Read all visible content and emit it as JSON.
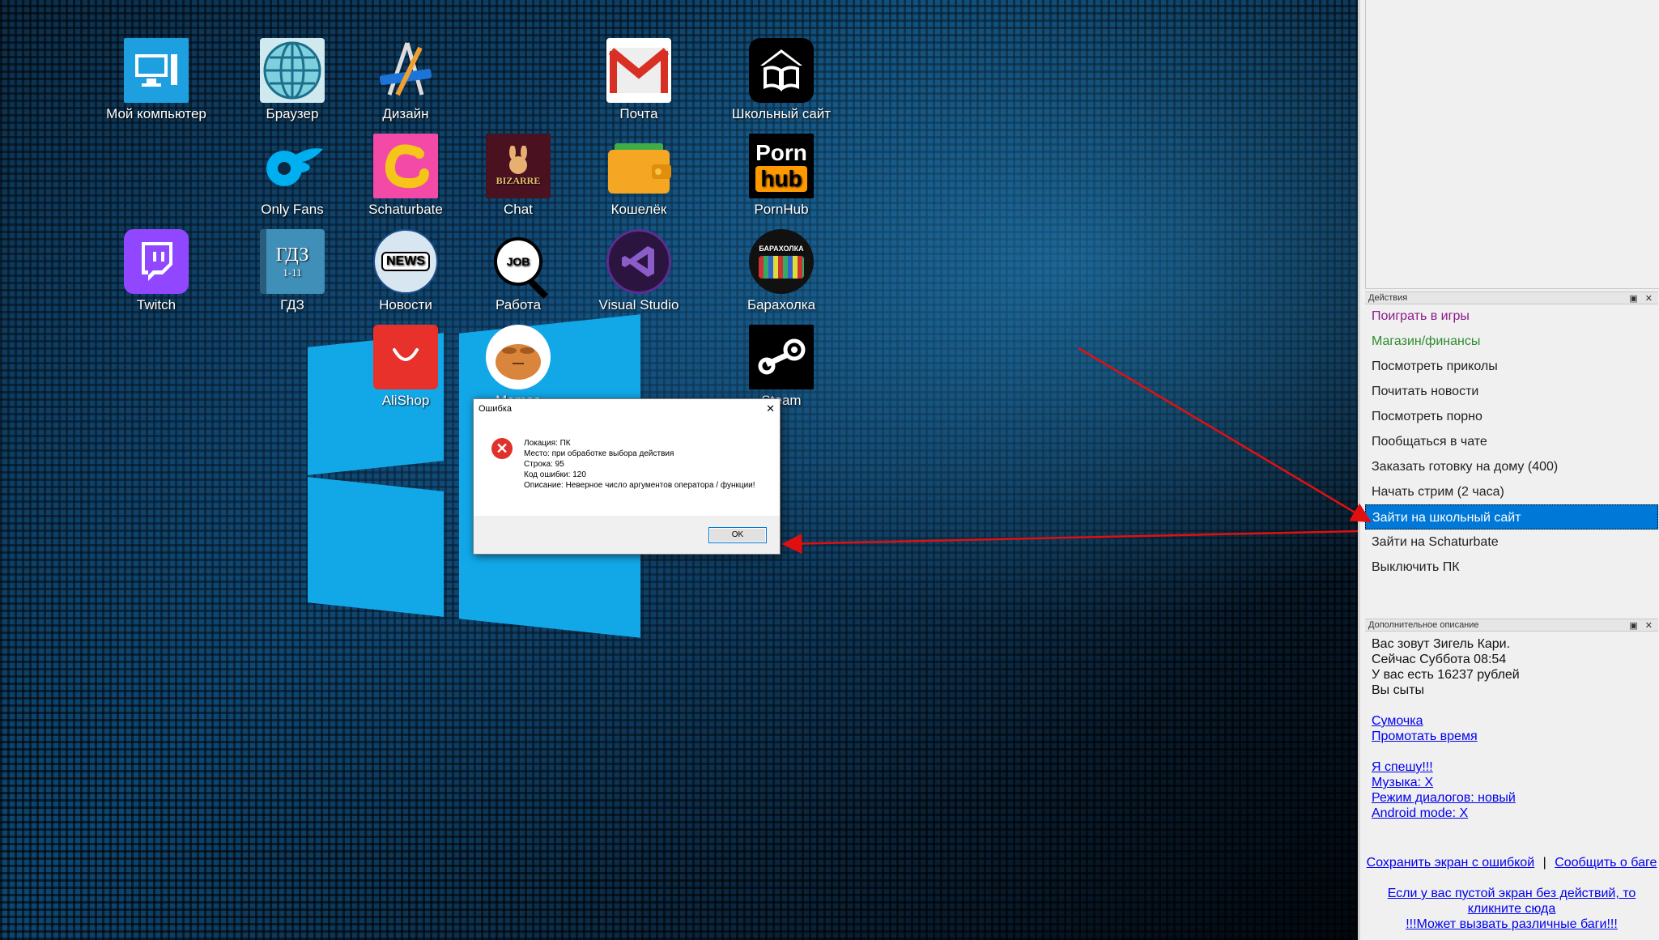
{
  "desktop": {
    "icons": [
      {
        "label": "Мой компьютер",
        "icon": "monitor-icon"
      },
      {
        "label": "Браузер",
        "icon": "globe-icon"
      },
      {
        "label": "Дизайн",
        "icon": "design-tools-icon"
      },
      {
        "label": "Почта",
        "icon": "mail-icon"
      },
      {
        "label": "Школьный сайт",
        "icon": "school-site-icon"
      },
      {
        "label": "Only Fans",
        "icon": "onlyfans-icon"
      },
      {
        "label": "Schaturbate",
        "icon": "schaturbate-icon"
      },
      {
        "label": "Chat",
        "icon": "chat-icon"
      },
      {
        "label": "Кошелёк",
        "icon": "wallet-icon"
      },
      {
        "label": "PornHub",
        "icon": "pornhub-icon"
      },
      {
        "label": "Twitch",
        "icon": "twitch-icon"
      },
      {
        "label": "ГДЗ",
        "icon": "gdz-book-icon"
      },
      {
        "label": "Новости",
        "icon": "news-icon"
      },
      {
        "label": "Работа",
        "icon": "job-search-icon"
      },
      {
        "label": "Visual Studio",
        "icon": "visual-studio-icon"
      },
      {
        "label": "Барахолка",
        "icon": "flea-market-icon"
      },
      {
        "label": "AliShop",
        "icon": "alishop-icon"
      },
      {
        "label": "Memes",
        "icon": "memes-icon"
      },
      {
        "label": "Steam",
        "icon": "steam-icon"
      }
    ],
    "icon_text": {
      "pornhub_top": "Porn",
      "pornhub_bottom": "hub",
      "gdz_top": "ГДЗ",
      "gdz_bottom": "1-11",
      "news": "NEWS",
      "job": "JOB",
      "bizarre": "BIZARRE",
      "flea": "БАРАХОЛКА"
    }
  },
  "dialog": {
    "title": "Ошибка",
    "close": "✕",
    "lines": [
      "Локация: ПК",
      "Место: при обработке выбора действия",
      "Строка: 95",
      "Код ошибки: 120",
      "Описание: Неверное число аргументов оператора / функции!"
    ],
    "ok_label": "OK"
  },
  "side": {
    "actions_header": "Действия",
    "actions": [
      {
        "label": "Поиграть в игры",
        "style": "purple"
      },
      {
        "label": "Магазин/финансы",
        "style": "green"
      },
      {
        "label": "Посмотреть приколы",
        "style": ""
      },
      {
        "label": "Почитать новости",
        "style": ""
      },
      {
        "label": "Посмотреть порно",
        "style": ""
      },
      {
        "label": "Пообщаться в чате",
        "style": ""
      },
      {
        "label": "Заказать готовку на дому (400)",
        "style": ""
      },
      {
        "label": "Начать стрим (2 часа)",
        "style": ""
      },
      {
        "label": "Зайти на школьный сайт",
        "style": "sel"
      },
      {
        "label": "Зайти на Schaturbate",
        "style": ""
      },
      {
        "label": "Выключить ПК",
        "style": ""
      }
    ],
    "desc_header": "Дополнительное описание",
    "header_buttons": "▣ ✕",
    "desc_lines": [
      "Вас зовут Зигель Кари.",
      "Сейчас Суббота 08:54",
      "У вас есть 16237 рублей",
      "Вы сыты"
    ],
    "links1": [
      "Сумочка",
      "Промотать время"
    ],
    "links2": [
      "Я спешу!!!",
      "Музыка: Х",
      "Режим диалогов: новый",
      "Android mode: Х"
    ],
    "save_link": "Сохранить экран с ошибкой",
    "separator": "|",
    "report_link": "Сообщить о баге",
    "empty_link": "Если у вас пустой экран без действий, то кликните сюда",
    "bugs_link": "!!!Может вызвать различные баги!!!"
  }
}
